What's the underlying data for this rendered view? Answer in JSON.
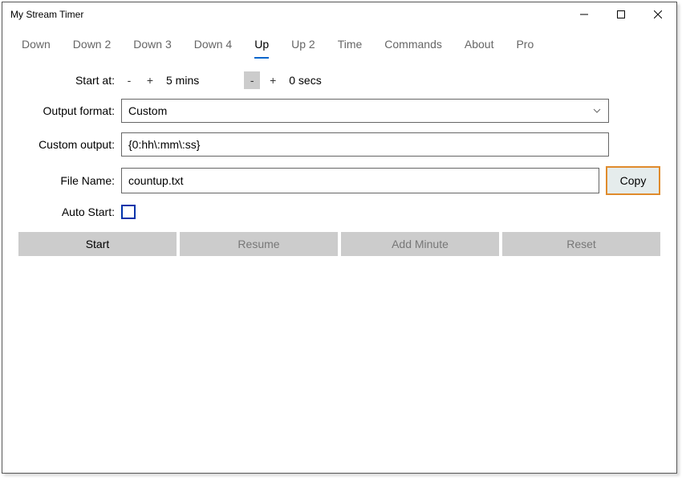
{
  "window": {
    "title": "My Stream Timer"
  },
  "tabs": [
    {
      "label": "Down",
      "active": false
    },
    {
      "label": "Down 2",
      "active": false
    },
    {
      "label": "Down 3",
      "active": false
    },
    {
      "label": "Down 4",
      "active": false
    },
    {
      "label": "Up",
      "active": true
    },
    {
      "label": "Up 2",
      "active": false
    },
    {
      "label": "Time",
      "active": false
    },
    {
      "label": "Commands",
      "active": false
    },
    {
      "label": "About",
      "active": false
    },
    {
      "label": "Pro",
      "active": false
    }
  ],
  "form": {
    "start_at_label": "Start at:",
    "mins_minus": "-",
    "mins_plus": "+",
    "mins_value": "5 mins",
    "secs_minus": "-",
    "secs_plus": "+",
    "secs_value": "0 secs",
    "output_format_label": "Output format:",
    "output_format_value": "Custom",
    "custom_output_label": "Custom output:",
    "custom_output_value": "{0:hh\\:mm\\:ss}",
    "file_name_label": "File Name:",
    "file_name_value": "countup.txt",
    "copy_label": "Copy",
    "auto_start_label": "Auto Start:",
    "auto_start_checked": false
  },
  "actions": {
    "start": "Start",
    "resume": "Resume",
    "add_minute": "Add Minute",
    "reset": "Reset"
  }
}
